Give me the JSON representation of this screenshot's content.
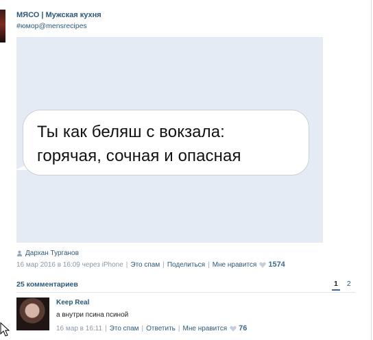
{
  "post": {
    "title": "МЯСО | Мужская кухня",
    "hashtag": "#юмор@mensrecipes",
    "image_text_line1": "Ты как беляш с вокзала:",
    "image_text_line2": "горячая, сочная и опасная",
    "author": "Дархан Турганов",
    "date": "16 мар 2016 в 16:09 через iPhone",
    "spam": "Это спам",
    "share": "Поделиться",
    "like": "Мне нравится",
    "likes_count": "1574"
  },
  "comments": {
    "title": "25 комментариев",
    "pages": [
      "1",
      "2"
    ],
    "items": [
      {
        "author": "Keep Real",
        "text": "а внутри псина псиной",
        "date": "16 мар в 16:11",
        "spam": "Это спам",
        "reply": "Ответить",
        "like": "Мне нравится",
        "likes_count": "76"
      }
    ]
  },
  "icons": {
    "author": "user-icon",
    "likes": "heart-icon",
    "cursor": "arrow-cursor-icon"
  },
  "colors": {
    "link": "#2b587a",
    "muted": "#8a97a6",
    "image_background": "#e4ebf4"
  }
}
